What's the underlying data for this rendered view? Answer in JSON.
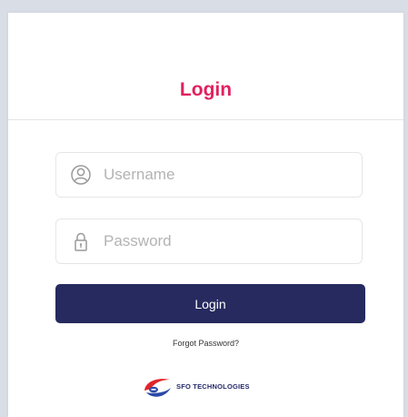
{
  "login": {
    "title": "Login",
    "username": {
      "placeholder": "Username",
      "value": ""
    },
    "password": {
      "placeholder": "Password",
      "value": ""
    },
    "submit_label": "Login",
    "forgot_password_label": "Forgot Password?"
  },
  "branding": {
    "company_name": "SFO TECHNOLOGIES"
  },
  "icons": {
    "username": "user-circle-icon",
    "password": "lock-icon",
    "logo": "sfo-logo-icon"
  },
  "colors": {
    "title": "#e0215f",
    "button": "#262a5e",
    "brand_text": "#262a6b",
    "logo_red": "#e0252b",
    "logo_blue": "#2b4aa8"
  }
}
